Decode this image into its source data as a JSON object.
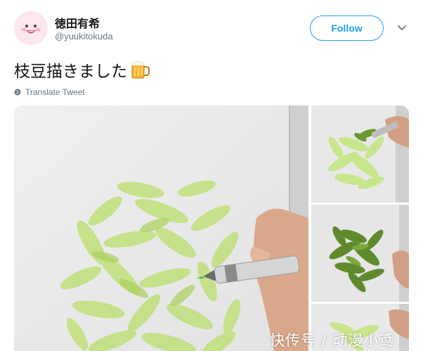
{
  "tweet": {
    "user": {
      "display_name": "徳田有希",
      "handle": "@yuukitokuda"
    },
    "follow_label": "Follow",
    "text": "枝豆描きました",
    "emoji": "beer-mug-icon",
    "translate_label": "Translate Tweet"
  },
  "colors": {
    "accent": "#1da1f2",
    "text_primary": "#14171a",
    "text_secondary": "#657786",
    "avatar_bg": "#fbe4ec"
  },
  "media": {
    "count": 4,
    "descriptions": [
      "edamame-drawing-marker",
      "edamame-drawing-start",
      "edamame-drawing-colored",
      "edamame-drawing-partial"
    ]
  },
  "watermark": {
    "text": "快传号 / 动漫小鸢"
  }
}
